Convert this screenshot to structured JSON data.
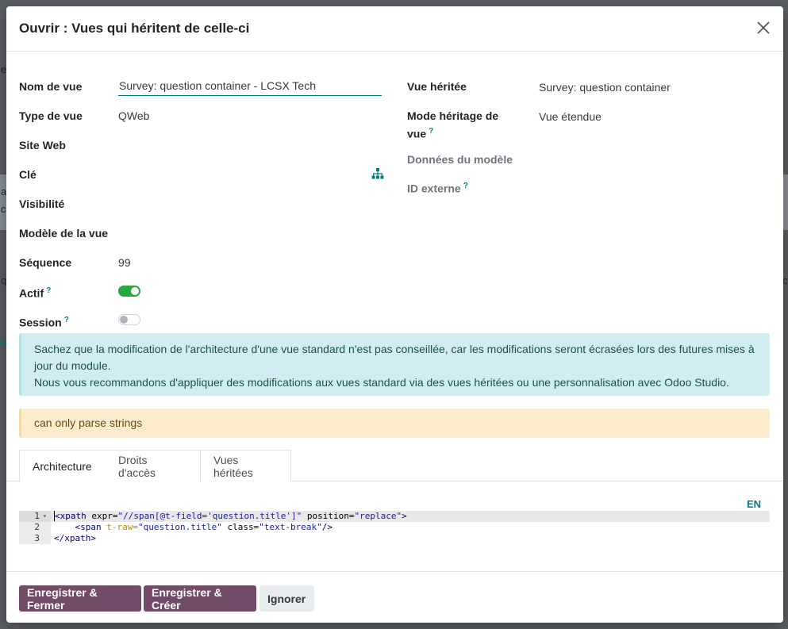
{
  "background": {
    "edge_text_1": "e",
    "edge_text_2": "a",
    "edge_text_3": "c",
    "edge_text_4": "q",
    "edge_text_5": "ct",
    "edge_text_6": "e"
  },
  "dialog": {
    "title": "Ouvrir : Vues qui héritent de celle-ci",
    "close_icon": "close-icon"
  },
  "form": {
    "left": {
      "view_name_label": "Nom de vue",
      "view_name_value": "Survey: question container - LCSX Tech",
      "view_type_label": "Type de vue",
      "view_type_value": "QWeb",
      "website_label": "Site Web",
      "key_label": "Clé",
      "key_icon": "sitemap-icon",
      "visibility_label": "Visibilité",
      "view_model_label": "Modèle de la vue",
      "sequence_label": "Séquence",
      "sequence_value": "99",
      "active_label": "Actif",
      "active_help": "?",
      "active_on": true,
      "session_label": "Session",
      "session_help": "?",
      "session_on": false
    },
    "right": {
      "inherited_view_label": "Vue héritée",
      "inherited_view_value": "Survey: question container",
      "inherit_mode_label_1": "Mode héritage de",
      "inherit_mode_label_2": "vue",
      "inherit_mode_help": "?",
      "inherit_mode_value": "Vue étendue",
      "model_data_label": "Données du modèle",
      "external_id_label": "ID externe",
      "external_id_help": "?"
    }
  },
  "alerts": {
    "info_line_1": "Sachez que la modification de l'architecture d'une vue standard n'est pas conseillée, car les modifications seront écrasées lors des futures mises à",
    "info_line_2": "jour du module.",
    "info_line_3": "Nous vous recommandons d'appliquer des modifications aux vues standard via des vues héritées ou une personnalisation avec Odoo Studio.",
    "warning": "can only parse strings"
  },
  "tabs": [
    {
      "label": "Architecture",
      "active": true
    },
    {
      "label": "Droits d'accès",
      "active": false
    },
    {
      "label": "Vues héritées",
      "active": false
    }
  ],
  "editor": {
    "lang_button": "EN",
    "lines": [
      {
        "num": "1",
        "parts": [
          {
            "t": "<",
            "c": "tk-tag"
          },
          {
            "t": "xpath",
            "c": "tk-tag"
          },
          {
            "t": " expr=",
            "c": "tk-attr"
          },
          {
            "t": "\"//span[@t-field='question.title']\"",
            "c": "tk-str"
          },
          {
            "t": " position=",
            "c": "tk-attr"
          },
          {
            "t": "\"replace\"",
            "c": "tk-str"
          },
          {
            "t": ">",
            "c": "tk-tag"
          }
        ]
      },
      {
        "num": "2",
        "parts": [
          {
            "t": "    <span",
            "c": "tk-tag"
          },
          {
            "t": " t-raw=",
            "c": "tk-attr2"
          },
          {
            "t": "\"question.title\"",
            "c": "tk-str"
          },
          {
            "t": " class=",
            "c": "tk-attr"
          },
          {
            "t": "\"text-break\"",
            "c": "tk-str"
          },
          {
            "t": "/>",
            "c": "tk-tag"
          }
        ]
      },
      {
        "num": "3",
        "parts": [
          {
            "t": "</xpath>",
            "c": "tk-tag"
          }
        ]
      }
    ]
  },
  "footer": {
    "save_close": "Enregistrer & Fermer",
    "save_new": "Enregistrer & Créer",
    "discard": "Ignorer"
  },
  "colors": {
    "primary": "#714b67",
    "accent": "#017e84",
    "toggle_on": "#28a745",
    "info_bg": "#d2edf1",
    "warning_bg": "#fcebcd"
  }
}
